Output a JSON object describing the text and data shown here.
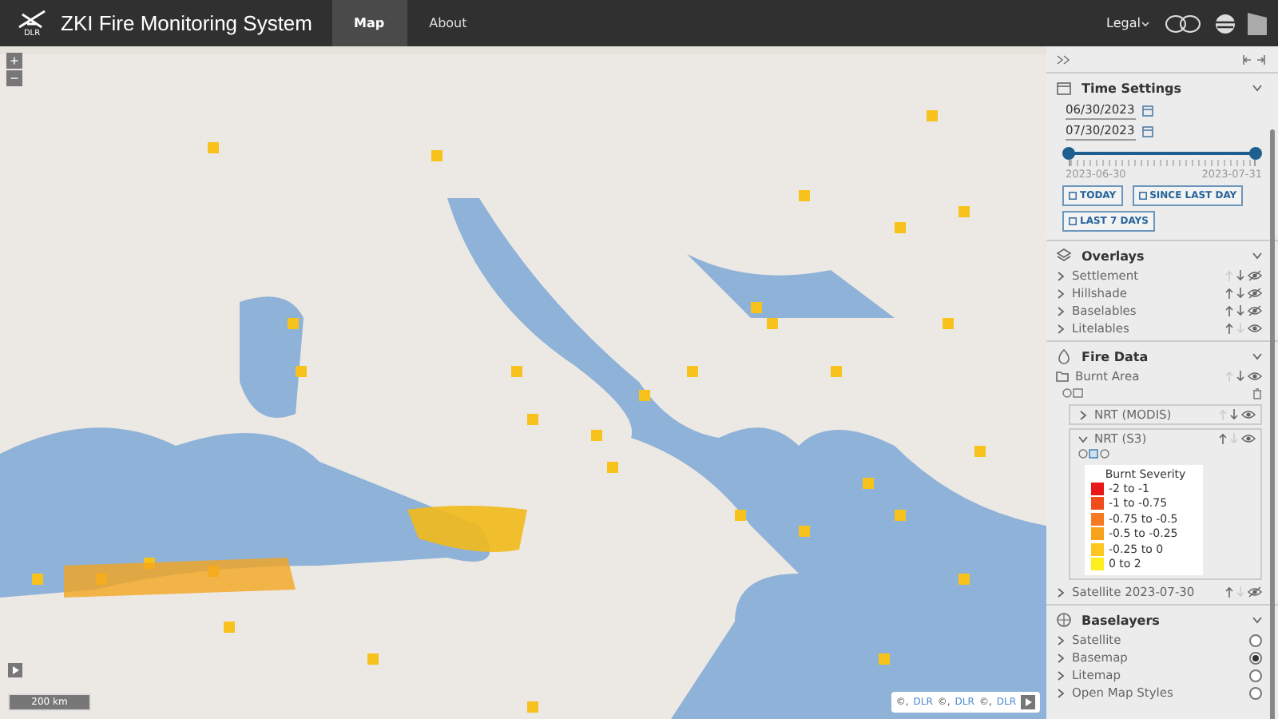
{
  "header": {
    "logo_text": "DLR",
    "title": "ZKI Fire Monitoring System",
    "nav": [
      {
        "label": "Map",
        "selected": true
      },
      {
        "label": "About",
        "selected": false
      }
    ],
    "legal": "Legal"
  },
  "map": {
    "zoom_in": "+",
    "zoom_out": "−",
    "scale": "200 km",
    "attributions": [
      {
        "prefix": "©,",
        "link": "DLR"
      },
      {
        "prefix": "©,",
        "link": "DLR"
      },
      {
        "prefix": "©,",
        "link": "DLR"
      }
    ]
  },
  "panel": {
    "time_settings": {
      "title": "Time Settings",
      "expanded": true,
      "start_date": "06/30/2023",
      "end_date": "07/30/2023",
      "handles": [
        {
          "level": 0
        },
        {
          "level": 1
        }
      ],
      "start_label": "2023-06-30",
      "end_label": "2023-07-31",
      "buttons": [
        "TODAY",
        "SINCE LAST DAY",
        "LAST 7 DAYS"
      ]
    },
    "overlays": {
      "title": "Overlays",
      "expanded": true,
      "items": [
        {
          "label": "Settlement",
          "up_enabled": false,
          "down_enabled": true,
          "visible": false
        },
        {
          "label": "Hillshade",
          "up_enabled": true,
          "down_enabled": true,
          "visible": false
        },
        {
          "label": "Baselables",
          "up_enabled": true,
          "down_enabled": true,
          "visible": false
        },
        {
          "label": "Litelables",
          "up_enabled": true,
          "down_enabled": false,
          "visible": true
        }
      ]
    },
    "fire_data": {
      "title": "Fire Data",
      "expanded": true,
      "folder": {
        "label": "Burnt Area",
        "up_enabled": false,
        "down_enabled": true,
        "visible": true,
        "children": [
          {
            "label": "NRT (MODIS)",
            "expanded": false,
            "up_enabled": false,
            "down_enabled": true,
            "visible": true
          },
          {
            "label": "NRT (S3)",
            "expanded": true,
            "up_enabled": true,
            "down_enabled": false,
            "visible": true,
            "legend": {
              "title": "Burnt Severity",
              "entries": [
                {
                  "label": "-2 to -1",
                  "color": "#e8181a"
                },
                {
                  "label": "-1 to -0.75",
                  "color": "#f04c1c"
                },
                {
                  "label": "-0.75 to -0.5",
                  "color": "#f57a22"
                },
                {
                  "label": "-0.5 to -0.25",
                  "color": "#f9a21c"
                },
                {
                  "label": "-0.25 to 0",
                  "color": "#fcc71e"
                },
                {
                  "label": "0 to 2",
                  "color": "#fdf01e"
                }
              ]
            }
          }
        ]
      },
      "items": [
        {
          "label": "Satellite 2023-07-30",
          "up_enabled": true,
          "down_enabled": false,
          "visible": false
        }
      ]
    },
    "baselayers": {
      "title": "Baselayers",
      "expanded": true,
      "items": [
        {
          "label": "Satellite",
          "selected": false
        },
        {
          "label": "Basemap",
          "selected": true
        },
        {
          "label": "Litemap",
          "selected": false
        },
        {
          "label": "Open Map Styles",
          "selected": false
        }
      ]
    }
  }
}
